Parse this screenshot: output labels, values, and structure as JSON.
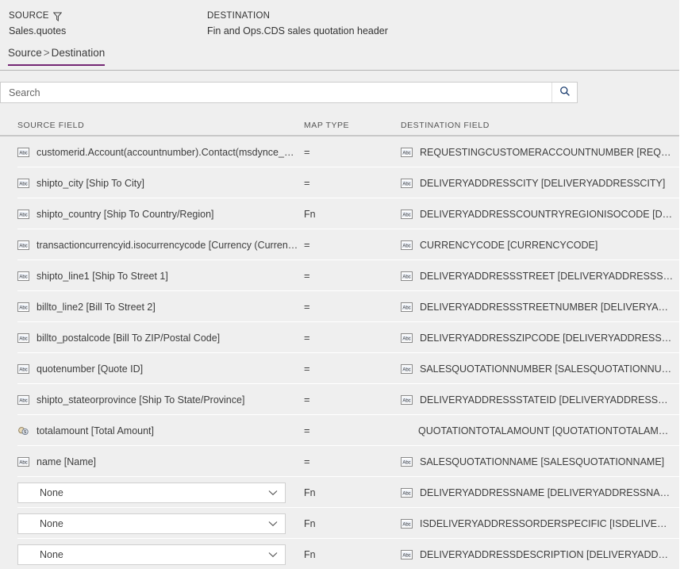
{
  "header": {
    "source_label": "SOURCE",
    "source_value": "Sales.quotes",
    "destination_label": "DESTINATION",
    "destination_value": "Fin and Ops.CDS sales quotation header",
    "filter_icon": "filter-icon"
  },
  "breadcrumb": {
    "source": "Source",
    "separator": ">",
    "destination": "Destination",
    "accent_color": "#742774"
  },
  "search": {
    "value": "",
    "placeholder": "Search",
    "button_icon": "search-icon"
  },
  "table": {
    "columns": {
      "source": "SOURCE FIELD",
      "map_type": "MAP TYPE",
      "destination": "DESTINATION FIELD"
    },
    "rows": [
      {
        "source_kind": "field",
        "source_icon": "text-field-icon",
        "source": "customerid.Account(accountnumber).Contact(msdynce_contac...",
        "map_type": "=",
        "dest_icon": "text-field-icon",
        "destination": "REQUESTINGCUSTOMERACCOUNTNUMBER [REQUESTINGCUS..."
      },
      {
        "source_kind": "field",
        "source_icon": "text-field-icon",
        "source": "shipto_city [Ship To City]",
        "map_type": "=",
        "dest_icon": "text-field-icon",
        "destination": "DELIVERYADDRESSCITY [DELIVERYADDRESSCITY]"
      },
      {
        "source_kind": "field",
        "source_icon": "text-field-icon",
        "source": "shipto_country [Ship To Country/Region]",
        "map_type": "Fn",
        "dest_icon": "text-field-icon",
        "destination": "DELIVERYADDRESSCOUNTRYREGIONISOCODE [DELIVERYADD..."
      },
      {
        "source_kind": "field",
        "source_icon": "text-field-icon",
        "source": "transactioncurrencyid.isocurrencycode [Currency (Currency Co...",
        "map_type": "=",
        "dest_icon": "text-field-icon",
        "destination": "CURRENCYCODE [CURRENCYCODE]"
      },
      {
        "source_kind": "field",
        "source_icon": "text-field-icon",
        "source": "shipto_line1 [Ship To Street 1]",
        "map_type": "=",
        "dest_icon": "text-field-icon",
        "destination": "DELIVERYADDRESSSTREET [DELIVERYADDRESSSTREET]"
      },
      {
        "source_kind": "field",
        "source_icon": "text-field-icon",
        "source": "billto_line2 [Bill To Street 2]",
        "map_type": "=",
        "dest_icon": "text-field-icon",
        "destination": "DELIVERYADDRESSSTREETNUMBER [DELIVERYADDRESSSTREET..."
      },
      {
        "source_kind": "field",
        "source_icon": "text-field-icon",
        "source": "billto_postalcode [Bill To ZIP/Postal Code]",
        "map_type": "=",
        "dest_icon": "text-field-icon",
        "destination": "DELIVERYADDRESSZIPCODE [DELIVERYADDRESSZIPCODE]"
      },
      {
        "source_kind": "field",
        "source_icon": "text-field-icon",
        "source": "quotenumber [Quote ID]",
        "map_type": "=",
        "dest_icon": "text-field-icon",
        "destination": "SALESQUOTATIONNUMBER [SALESQUOTATIONNUMBER]"
      },
      {
        "source_kind": "field",
        "source_icon": "text-field-icon",
        "source": "shipto_stateorprovince [Ship To State/Province]",
        "map_type": "=",
        "dest_icon": "text-field-icon",
        "destination": "DELIVERYADDRESSSTATEID [DELIVERYADDRESSSTATEID]"
      },
      {
        "source_kind": "field",
        "source_icon": "money-field-icon",
        "source": "totalamount [Total Amount]",
        "map_type": "=",
        "dest_icon": "none",
        "destination": "QUOTATIONTOTALAMOUNT [QUOTATIONTOTALAMOUNT]"
      },
      {
        "source_kind": "field",
        "source_icon": "text-field-icon",
        "source": "name [Name]",
        "map_type": "=",
        "dest_icon": "text-field-icon",
        "destination": "SALESQUOTATIONNAME [SALESQUOTATIONNAME]"
      },
      {
        "source_kind": "dropdown",
        "source_icon": "chevron-down-icon",
        "source": "None",
        "map_type": "Fn",
        "dest_icon": "text-field-icon",
        "destination": "DELIVERYADDRESSNAME [DELIVERYADDRESSNAME]"
      },
      {
        "source_kind": "dropdown",
        "source_icon": "chevron-down-icon",
        "source": "None",
        "map_type": "Fn",
        "dest_icon": "text-field-icon",
        "destination": "ISDELIVERYADDRESSORDERSPECIFIC [ISDELIVERYADDRESSOR..."
      },
      {
        "source_kind": "dropdown",
        "source_icon": "chevron-down-icon",
        "source": "None",
        "map_type": "Fn",
        "dest_icon": "text-field-icon",
        "destination": "DELIVERYADDRESSDESCRIPTION [DELIVERYADDRESSDESCRIPT..."
      }
    ]
  }
}
